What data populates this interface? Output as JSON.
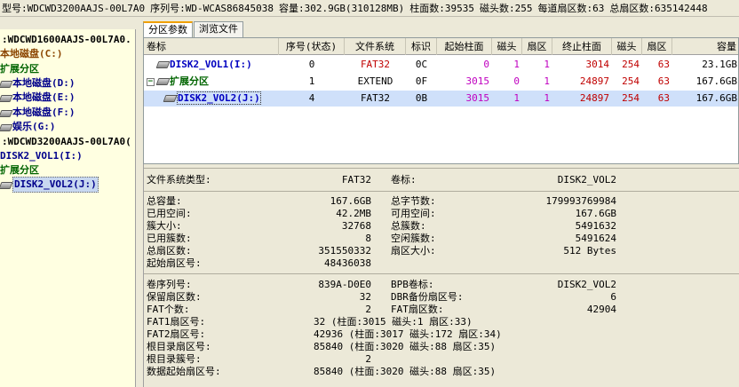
{
  "topbar": {
    "model": "型号:WDCWD3200AAJS-00L7A0",
    "serial": "序列号:WD-WCAS86845038",
    "capacity": "容量:302.9GB(310128MB)",
    "cylinders": "柱面数:39535",
    "heads": "磁头数:255",
    "sectors_per_track": "每道扇区数:63",
    "total_sectors": "总扇区数:635142448"
  },
  "tree": [
    {
      "label": ":WDCWD1600AAJS-00L7A0.",
      "kind": "disk"
    },
    {
      "label": "本地磁盘(C:)",
      "kind": "ext"
    },
    {
      "label": "扩展分区",
      "kind": "ext"
    },
    {
      "label": "本地磁盘(D:)",
      "kind": "vol"
    },
    {
      "label": "本地磁盘(E:)",
      "kind": "vol"
    },
    {
      "label": "本地磁盘(F:)",
      "kind": "vol"
    },
    {
      "label": "娱乐(G:)",
      "kind": "vol"
    },
    {
      "label": ":WDCWD3200AAJS-00L7A0(",
      "kind": "disk"
    },
    {
      "label": "DISK2_VOL1(I:)",
      "kind": "vol"
    },
    {
      "label": "扩展分区",
      "kind": "ext"
    },
    {
      "label": "DISK2_VOL2(J:)",
      "kind": "vol"
    }
  ],
  "tabs": [
    "分区参数",
    "浏览文件"
  ],
  "table": {
    "headers": [
      "卷标",
      "序号(状态)",
      "文件系统",
      "标识",
      "起始柱面",
      "磁头",
      "扇区",
      "终止柱面",
      "磁头",
      "扇区",
      "容量"
    ],
    "rows": [
      {
        "name": "DISK2_VOL1(I:)",
        "num": "0",
        "fs": "FAT32",
        "id": "0C",
        "start_cyl": "0",
        "start_head": "1",
        "start_sec": "1",
        "end_cyl": "3014",
        "end_head": "254",
        "end_sec": "63",
        "capacity": "23.1GB"
      },
      {
        "name": "扩展分区",
        "num": "1",
        "fs": "EXTEND",
        "id": "0F",
        "start_cyl": "3015",
        "start_head": "0",
        "start_sec": "1",
        "end_cyl": "24897",
        "end_head": "254",
        "end_sec": "63",
        "capacity": "167.6GB"
      },
      {
        "name": "DISK2_VOL2(J:)",
        "num": "4",
        "fs": "FAT32",
        "id": "0B",
        "start_cyl": "3015",
        "start_head": "1",
        "start_sec": "1",
        "end_cyl": "24897",
        "end_head": "254",
        "end_sec": "63",
        "capacity": "167.6GB"
      }
    ]
  },
  "details": {
    "fs_type_label": "文件系统类型:",
    "fs_type": "FAT32",
    "volume_label_label": "卷标:",
    "volume_label": "DISK2_VOL2",
    "total_capacity_label": "总容量:",
    "total_capacity": "167.6GB",
    "total_bytes_label": "总字节数:",
    "total_bytes": "179993769984",
    "used_space_label": "已用空间:",
    "used_space": "42.2MB",
    "free_space_label": "可用空间:",
    "free_space": "167.6GB",
    "cluster_size_label": "簇大小:",
    "cluster_size": "32768",
    "total_clusters_label": "总簇数:",
    "total_clusters": "5491632",
    "used_clusters_label": "已用簇数:",
    "used_clusters": "8",
    "free_clusters_label": "空闲簇数:",
    "free_clusters": "5491624",
    "total_sectors_label": "总扇区数:",
    "total_sectors": "351550332",
    "sector_size_label": "扇区大小:",
    "sector_size": "512 Bytes",
    "start_sector_label": "起始扇区号:",
    "start_sector": "48436038",
    "serial_label": "卷序列号:",
    "serial": "839A-D0E0",
    "bpb_label_label": "BPB卷标:",
    "bpb_label": "DISK2_VOL2",
    "reserved_label": "保留扇区数:",
    "reserved": "32",
    "dbr_backup_label": "DBR备份扇区号:",
    "dbr_backup": "6",
    "fat_count_label": "FAT个数:",
    "fat_count": "2",
    "fat_sectors_label": "FAT扇区数:",
    "fat_sectors": "42904",
    "fat1_label": "FAT1扇区号:",
    "fat1": "32 (柱面:3015 磁头:1 扇区:33)",
    "fat2_label": "FAT2扇区号:",
    "fat2": "42936 (柱面:3017 磁头:172 扇区:34)",
    "root_sector_label": "根目录扇区号:",
    "root_sector": "85840 (柱面:3020 磁头:88 扇区:35)",
    "root_cluster_label": "根目录簇号:",
    "root_cluster": "2",
    "data_start_label": "数据起始扇区号:",
    "data_start": "85840 (柱面:3020 磁头:88 扇区:35)"
  },
  "colors": {
    "tree_bg": "#ffffe1",
    "selection": "#cfe0fa",
    "accent_tab": "#f0a000"
  }
}
